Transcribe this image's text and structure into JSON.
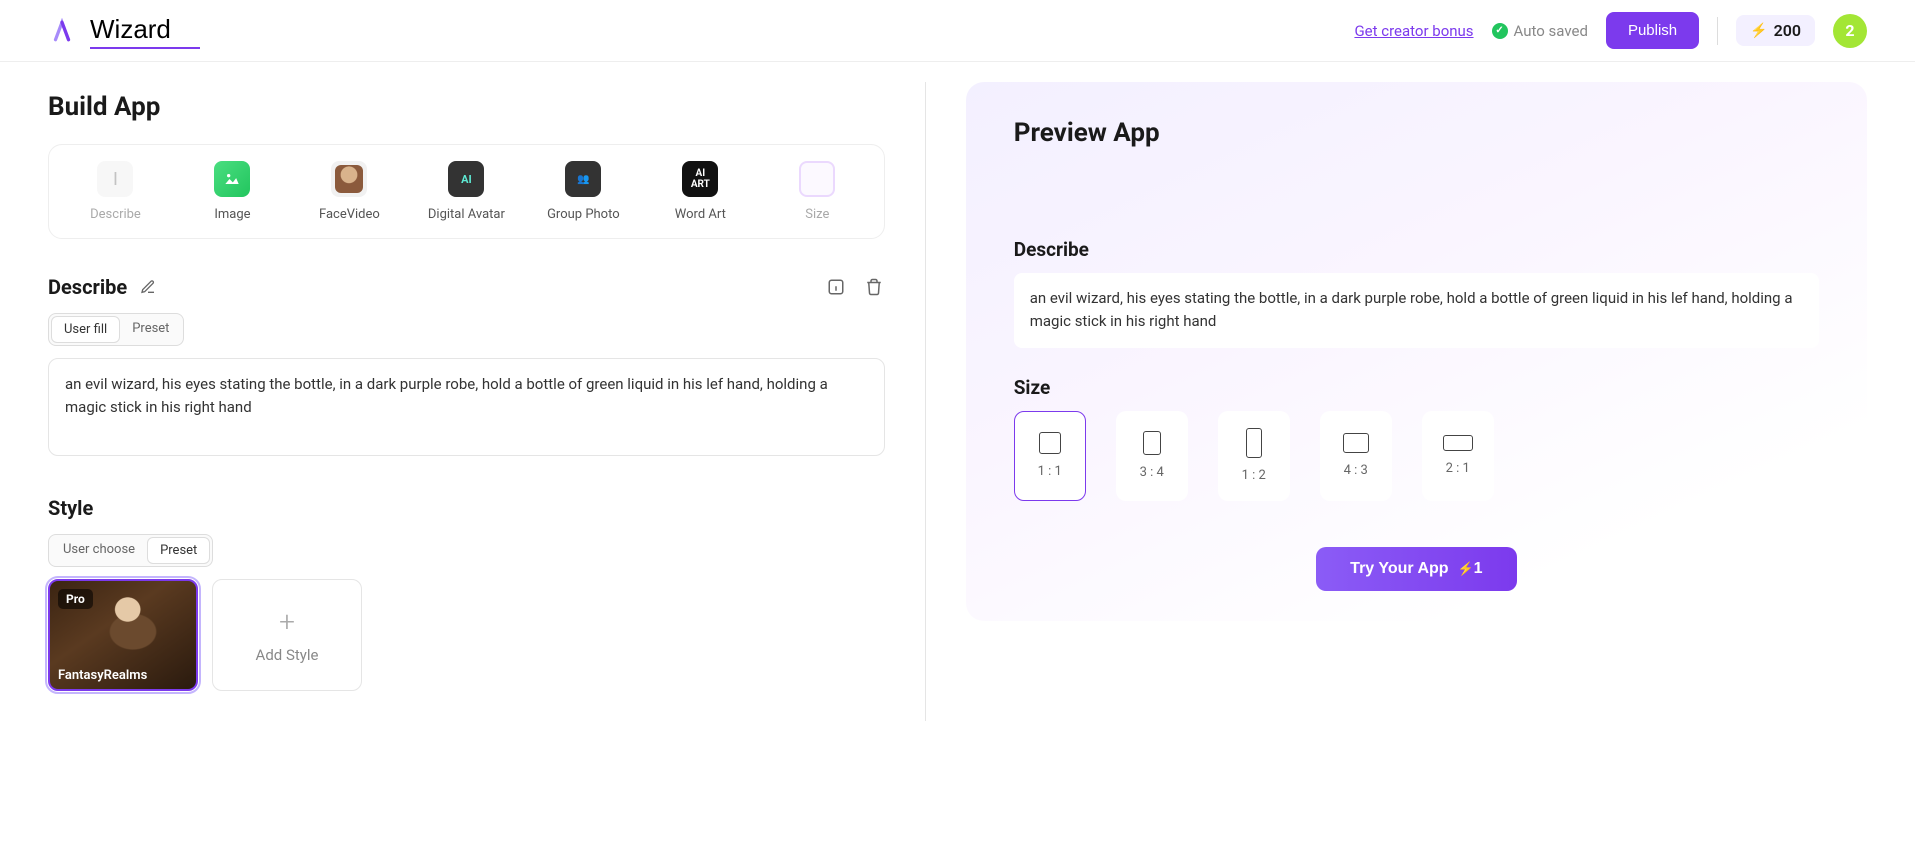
{
  "header": {
    "app_name": "Wizard",
    "creator_bonus": "Get creator bonus",
    "autosaved": "Auto saved",
    "publish": "Publish",
    "credits": "200",
    "avatar_initial": "2"
  },
  "build": {
    "title": "Build App",
    "tools": [
      {
        "label": "Describe",
        "icon": "text"
      },
      {
        "label": "Image",
        "icon": "image"
      },
      {
        "label": "FaceVideo",
        "icon": "face"
      },
      {
        "label": "Digital Avatar",
        "icon": "avatar"
      },
      {
        "label": "Group Photo",
        "icon": "group"
      },
      {
        "label": "Word Art",
        "icon": "wordart"
      },
      {
        "label": "Size",
        "icon": "size"
      }
    ],
    "describe": {
      "heading": "Describe",
      "tabs": {
        "user_fill": "User fill",
        "preset": "Preset",
        "active": "user_fill"
      },
      "value": "an evil wizard, his eyes stating the bottle, in a dark purple robe, hold a bottle of green liquid in his lef hand, holding a magic stick in his right hand"
    },
    "style": {
      "heading": "Style",
      "tabs": {
        "user_choose": "User choose",
        "preset": "Preset",
        "active": "preset"
      },
      "selected": {
        "pro": "Pro",
        "name": "FantasyRealms"
      },
      "add_label": "Add Style"
    }
  },
  "preview": {
    "title": "Preview App",
    "describe_heading": "Describe",
    "describe_text": "an evil wizard, his eyes stating the bottle, in a dark purple robe, hold a bottle of green liquid in his lef hand, holding a magic stick in his right hand",
    "size_heading": "Size",
    "sizes": [
      "1 : 1",
      "3 : 4",
      "1 : 2",
      "4 : 3",
      "2 : 1"
    ],
    "active_size": "1 : 1",
    "try_label": "Try Your App",
    "try_cost": "1"
  }
}
